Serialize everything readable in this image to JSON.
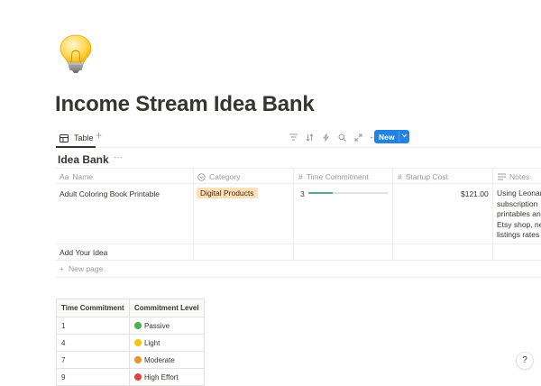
{
  "page": {
    "icon": "lightbulb-icon",
    "title": "Income Stream Idea Bank"
  },
  "view": {
    "tab_label": "Table",
    "tab_icon": "table-icon",
    "add_view": "+",
    "new_button": "New"
  },
  "database": {
    "title": "Idea Bank",
    "menu": "···",
    "columns": [
      {
        "label": "Name",
        "icon": "text-prefix-icon",
        "prefix": "Aa"
      },
      {
        "label": "Category",
        "icon": "select-icon"
      },
      {
        "label": "Time Commitment",
        "icon": "number-icon",
        "prefix": "#"
      },
      {
        "label": "Startup Cost",
        "icon": "number-icon",
        "prefix": "#"
      },
      {
        "label": "Notes",
        "icon": "text-lines-icon"
      }
    ],
    "rows": [
      {
        "name": "Adult Coloring Book Printable",
        "category": "Digital Products",
        "category_color": "#fae0b8",
        "time_commitment": "3",
        "time_progress": 0.3,
        "startup_cost": "$121.00",
        "notes": [
          "Using Leonar",
          "subscription",
          "printables an",
          "Etsy shop, ne",
          "listings rates"
        ]
      },
      {
        "name": "Add Your Idea",
        "category": "",
        "time_commitment": "",
        "startup_cost": "",
        "notes": []
      }
    ],
    "new_page": "New page"
  },
  "legend": {
    "headers": [
      "Time Commitment",
      "Commitment Level"
    ],
    "rows": [
      {
        "value": "1",
        "level": "Passive",
        "color": "#4caf50"
      },
      {
        "value": "4",
        "level": "Light",
        "color": "#f5c518"
      },
      {
        "value": "7",
        "level": "Moderate",
        "color": "#f0902c"
      },
      {
        "value": "9",
        "level": "High Effort",
        "color": "#e0443c"
      }
    ]
  },
  "help": {
    "label": "?"
  }
}
